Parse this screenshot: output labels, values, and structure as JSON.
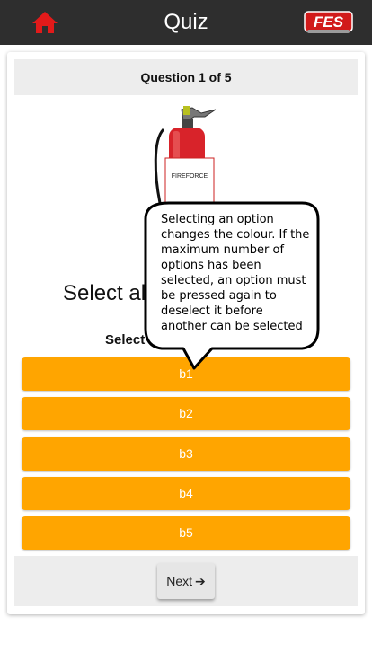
{
  "header": {
    "title": "Quiz",
    "home_icon": "home-icon",
    "logo_text": "FES",
    "home_color": "#e21a1a",
    "bar_color": "#2e2e2e"
  },
  "quiz": {
    "progress_label": "Question 1 of 5",
    "image_label": "FIREFORCE",
    "question_text": "Select al",
    "instruction_text": "Select a",
    "options": [
      "b1",
      "b2",
      "b3",
      "b4",
      "b5"
    ],
    "option_color": "#ffa500",
    "next_label": "Next",
    "next_icon": "arrow-right-icon"
  },
  "tooltip": {
    "text": "Selecting an option changes the colour. If the maximum number of options has been selected, an option must be pressed again to deselect it before another can be selected"
  }
}
